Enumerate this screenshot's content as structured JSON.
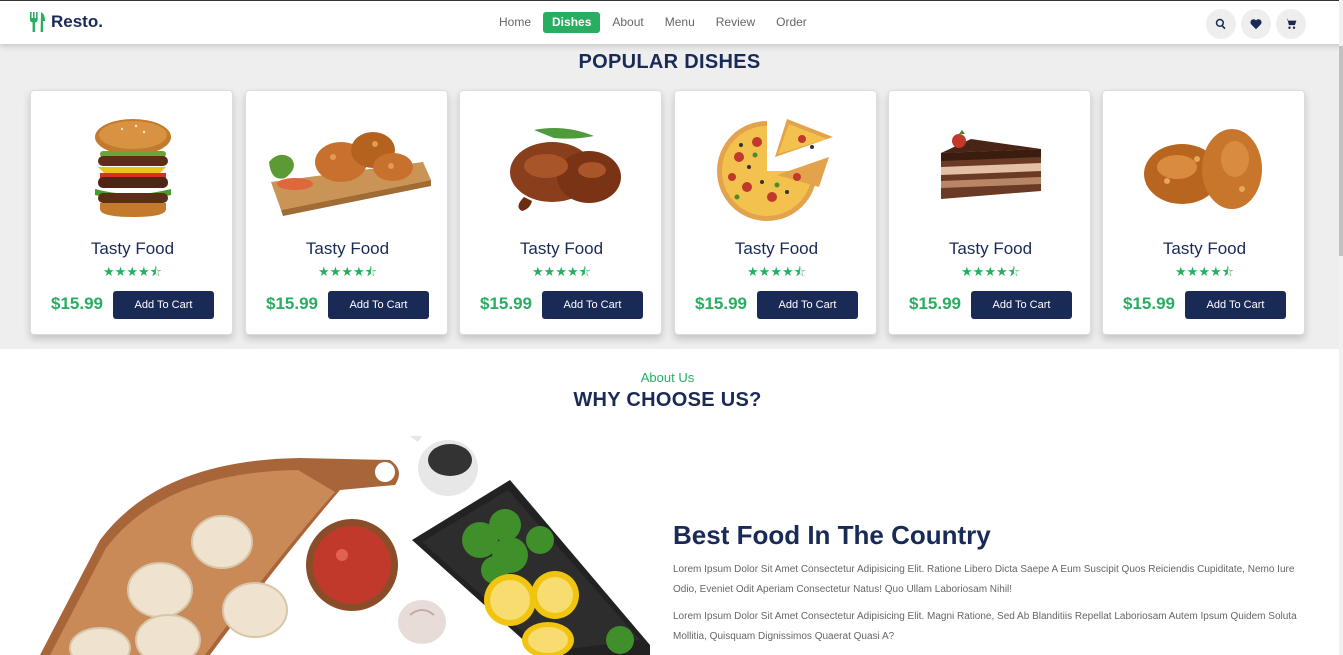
{
  "header": {
    "logo_text": "Resto.",
    "nav": [
      "Home",
      "Dishes",
      "About",
      "Menu",
      "Review",
      "Order"
    ],
    "active_nav": "Dishes",
    "icons": [
      "search-icon",
      "heart-icon",
      "shopping-cart-icon"
    ]
  },
  "dishes": {
    "title": "POPULAR DISHES",
    "cards": [
      {
        "image": "burger",
        "name": "Tasty Food",
        "stars": "★★★★⯪",
        "rating": 4.5,
        "price": "$15.99",
        "button": "Add To Cart"
      },
      {
        "image": "fried-chicken-board",
        "name": "Tasty Food",
        "stars": "★★★★⯪",
        "rating": 4.5,
        "price": "$15.99",
        "button": "Add To Cart"
      },
      {
        "image": "roast-chicken",
        "name": "Tasty Food",
        "stars": "★★★★⯪",
        "rating": 4.5,
        "price": "$15.99",
        "button": "Add To Cart"
      },
      {
        "image": "pizza",
        "name": "Tasty Food",
        "stars": "★★★★⯪",
        "rating": 4.5,
        "price": "$15.99",
        "button": "Add To Cart"
      },
      {
        "image": "chocolate-cake",
        "name": "Tasty Food",
        "stars": "★★★★⯪",
        "rating": 4.5,
        "price": "$15.99",
        "button": "Add To Cart"
      },
      {
        "image": "fried-chicken",
        "name": "Tasty Food",
        "stars": "★★★★⯪",
        "rating": 4.5,
        "price": "$15.99",
        "button": "Add To Cart"
      }
    ]
  },
  "about": {
    "subtitle": "About Us",
    "title": "WHY CHOOSE US?",
    "heading": "Best Food In The Country",
    "paragraph1": "Lorem Ipsum Dolor Sit Amet Consectetur Adipisicing Elit. Ratione Libero Dicta Saepe A Eum Suscipit Quos Reiciendis Cupiditate, Nemo Iure Odio, Eveniet Odit Aperiam Consectetur Natus! Quo Ullam Laboriosam Nihil!",
    "paragraph2": "Lorem Ipsum Dolor Sit Amet Consectetur Adipisicing Elit. Magni Ratione, Sed Ab Blanditiis Repellat Laboriosam Autem Ipsum Quidem Soluta Mollitia, Quisquam Dignissimos Quaerat Quasi A?"
  },
  "colors": {
    "primary": "#192a56",
    "accent": "#27ae60",
    "section_bg": "#eeeeee"
  }
}
